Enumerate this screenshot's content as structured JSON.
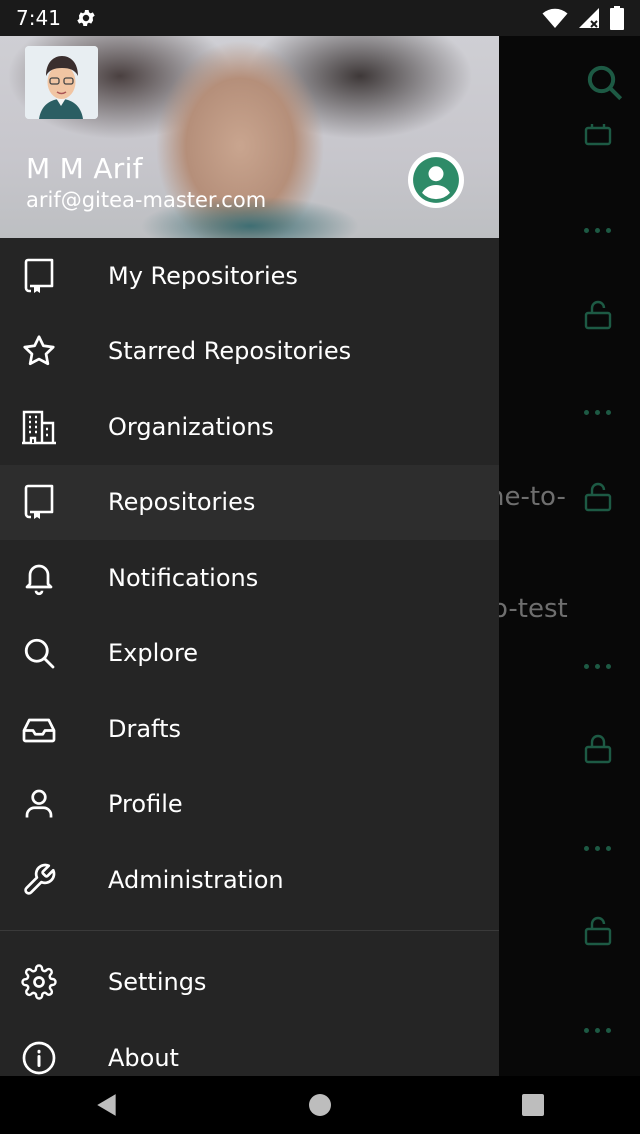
{
  "status_bar": {
    "time": "7:41"
  },
  "drawer": {
    "user": {
      "name": "M M Arif",
      "email": "arif@gitea-master.com"
    },
    "menu": [
      {
        "label": "My Repositories",
        "icon": "repo-icon"
      },
      {
        "label": "Starred Repositories",
        "icon": "star-icon"
      },
      {
        "label": "Organizations",
        "icon": "building-icon"
      },
      {
        "label": "Repositories",
        "icon": "repo-icon",
        "active": true
      },
      {
        "label": "Notifications",
        "icon": "bell-icon"
      },
      {
        "label": "Explore",
        "icon": "search-icon"
      },
      {
        "label": "Drafts",
        "icon": "inbox-icon"
      },
      {
        "label": "Profile",
        "icon": "user-icon"
      },
      {
        "label": "Administration",
        "icon": "wrench-icon"
      }
    ],
    "menu_secondary": [
      {
        "label": "Settings",
        "icon": "gear-icon"
      },
      {
        "label": "About",
        "icon": "info-icon"
      }
    ]
  },
  "background": {
    "text_1": "ne-to-",
    "text_2": "o-test"
  },
  "colors": {
    "accent": "#2e8b68",
    "drawer_bg": "#252525",
    "active_bg": "#2d2d2d"
  }
}
